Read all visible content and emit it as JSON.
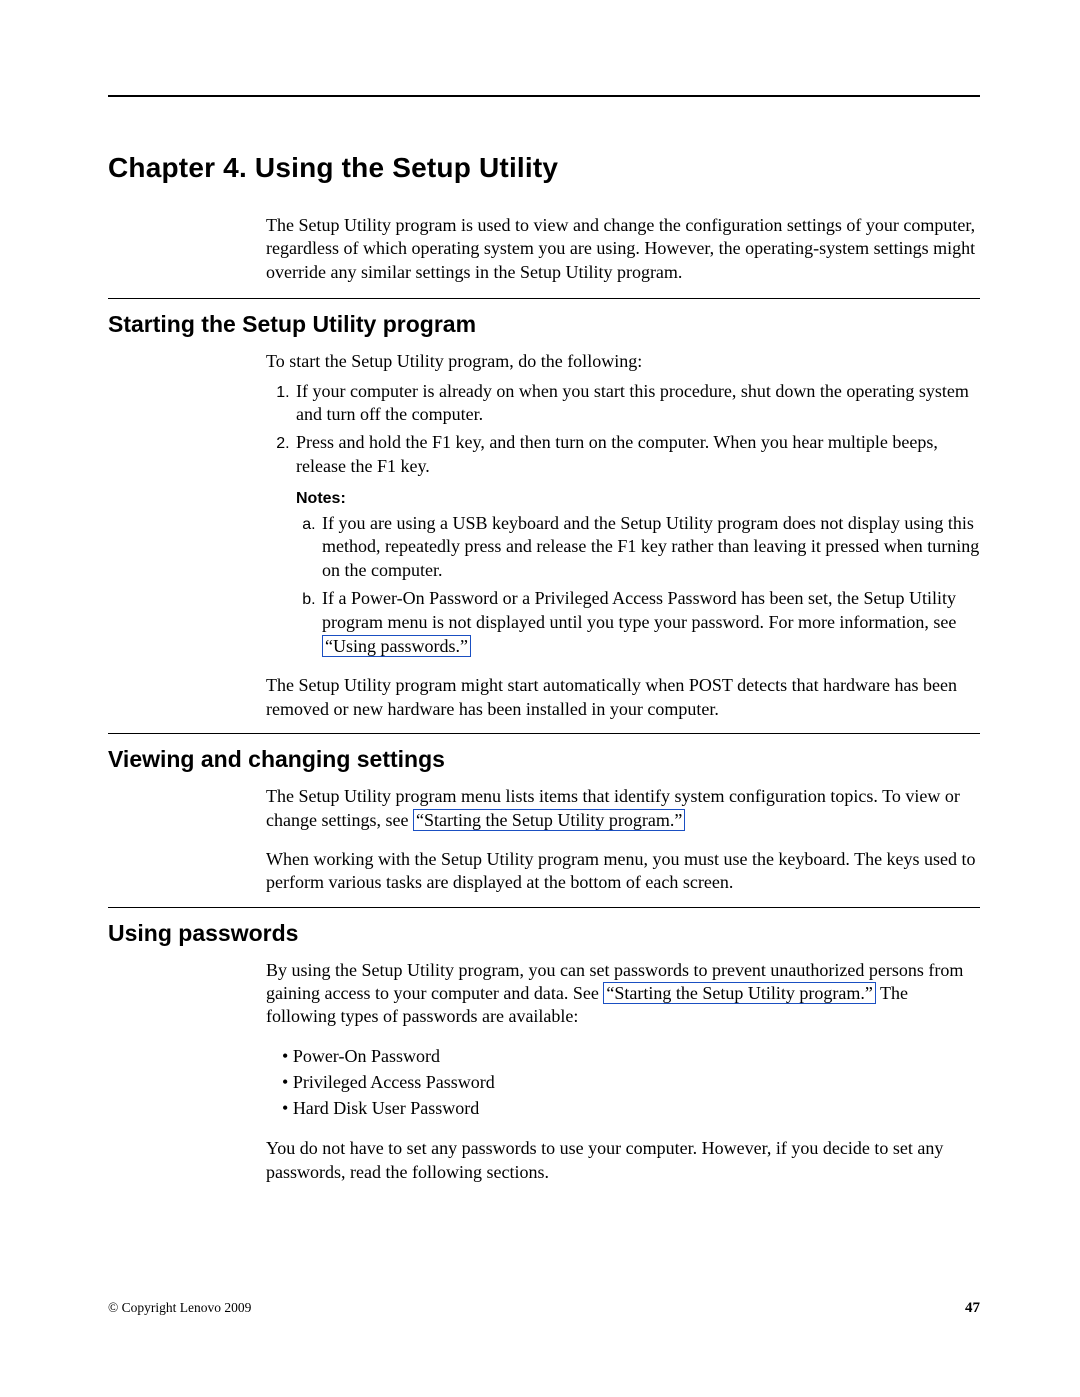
{
  "chapter_title": "Chapter 4. Using the Setup Utility",
  "intro": "The Setup Utility program is used to view and change the configuration settings of your computer, regardless of which operating system you are using. However, the operating-system settings might override any similar settings in the Setup Utility program.",
  "section1": {
    "title": "Starting the Setup Utility program",
    "lead": "To start the Setup Utility program, do the following:",
    "steps": [
      "If your computer is already on when you start this procedure, shut down the operating system and turn off the computer.",
      "Press and hold the F1 key, and then turn on the computer. When you hear multiple beeps, release the F1 key."
    ],
    "notes_label": "Notes:",
    "notes": {
      "a": "If you are using a USB keyboard and the Setup Utility program does not display using this method, repeatedly press and release the F1 key rather than leaving it pressed when turning on the computer.",
      "b_pre": "If a Power-On Password or a Privileged Access Password has been set, the Setup Utility program menu is not displayed until you type your password. For more information, see ",
      "b_link": "“Using passwords.”"
    },
    "tail": "The Setup Utility program might start automatically when POST detects that hardware has been removed or new hardware has been installed in your computer."
  },
  "section2": {
    "title": "Viewing and changing settings",
    "p1_pre": "The Setup Utility program menu lists items that identify system configuration topics. To view or change settings, see ",
    "p1_link": "“Starting the Setup Utility program.”",
    "p2": "When working with the Setup Utility program menu, you must use the keyboard. The keys used to perform various tasks are displayed at the bottom of each screen."
  },
  "section3": {
    "title": "Using passwords",
    "p1_pre": "By using the Setup Utility program, you can set passwords to prevent unauthorized persons from gaining access to your computer and data. See ",
    "p1_link": "“Starting the Setup Utility program.”",
    "p1_post": " The following types of passwords are available:",
    "bullets": [
      "Power-On Password",
      "Privileged Access Password",
      "Hard Disk User Password"
    ],
    "p2": "You do not have to set any passwords to use your computer. However, if you decide to set any passwords, read the following sections."
  },
  "footer": {
    "copyright": "© Copyright Lenovo 2009",
    "page": "47"
  }
}
